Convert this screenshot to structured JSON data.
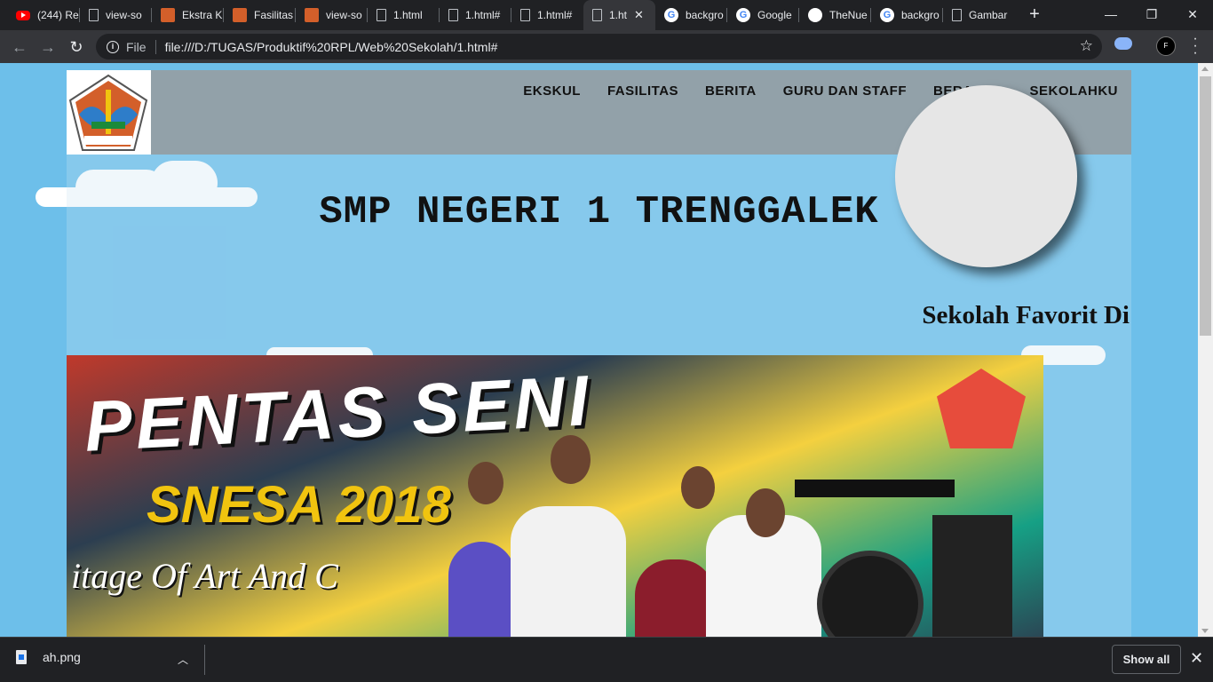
{
  "browser": {
    "tabs": [
      {
        "title": "(244) Re",
        "icon": "youtube-icon"
      },
      {
        "title": "view-so",
        "icon": "document-icon"
      },
      {
        "title": "Ekstra K",
        "icon": "school-logo-icon"
      },
      {
        "title": "Fasilitas",
        "icon": "school-logo-icon"
      },
      {
        "title": "view-so",
        "icon": "school-logo-icon"
      },
      {
        "title": "1.html",
        "icon": "document-icon"
      },
      {
        "title": "1.html#",
        "icon": "document-icon"
      },
      {
        "title": "1.html#",
        "icon": "document-icon"
      },
      {
        "title": "1.ht",
        "icon": "document-icon",
        "active": true
      },
      {
        "title": "backgro",
        "icon": "google-icon"
      },
      {
        "title": "Google",
        "icon": "google-icon"
      },
      {
        "title": "TheNue",
        "icon": "github-icon"
      },
      {
        "title": "backgro",
        "icon": "google-icon"
      },
      {
        "title": "Gambar",
        "icon": "document-icon"
      }
    ],
    "address": {
      "protocol_label": "File",
      "url": "file:///D:/TUGAS/Produktif%20RPL/Web%20Sekolah/1.html#"
    },
    "profile_initial": "F"
  },
  "page": {
    "nav": [
      "EKSKUL",
      "FASILITAS",
      "BERITA",
      "GURU DAN STAFF",
      "BERANDA",
      "SEKOLAHKU"
    ],
    "logo_text": "SMPN 1 TRENGGALEK",
    "title": "SMP NEGERI 1 TRENGGALEK",
    "marquee": "Sekolah Favorit Di",
    "photo": {
      "banner": "PENTAS SENI",
      "event": "SNESA 2018",
      "tagline": "itage Of Art And C"
    }
  },
  "downloads": {
    "file": "ah.png",
    "show_all": "Show all"
  },
  "colors": {
    "page_bg": "#6dbfea",
    "chrome_dark": "#202124",
    "chrome_toolbar": "#35363a"
  }
}
